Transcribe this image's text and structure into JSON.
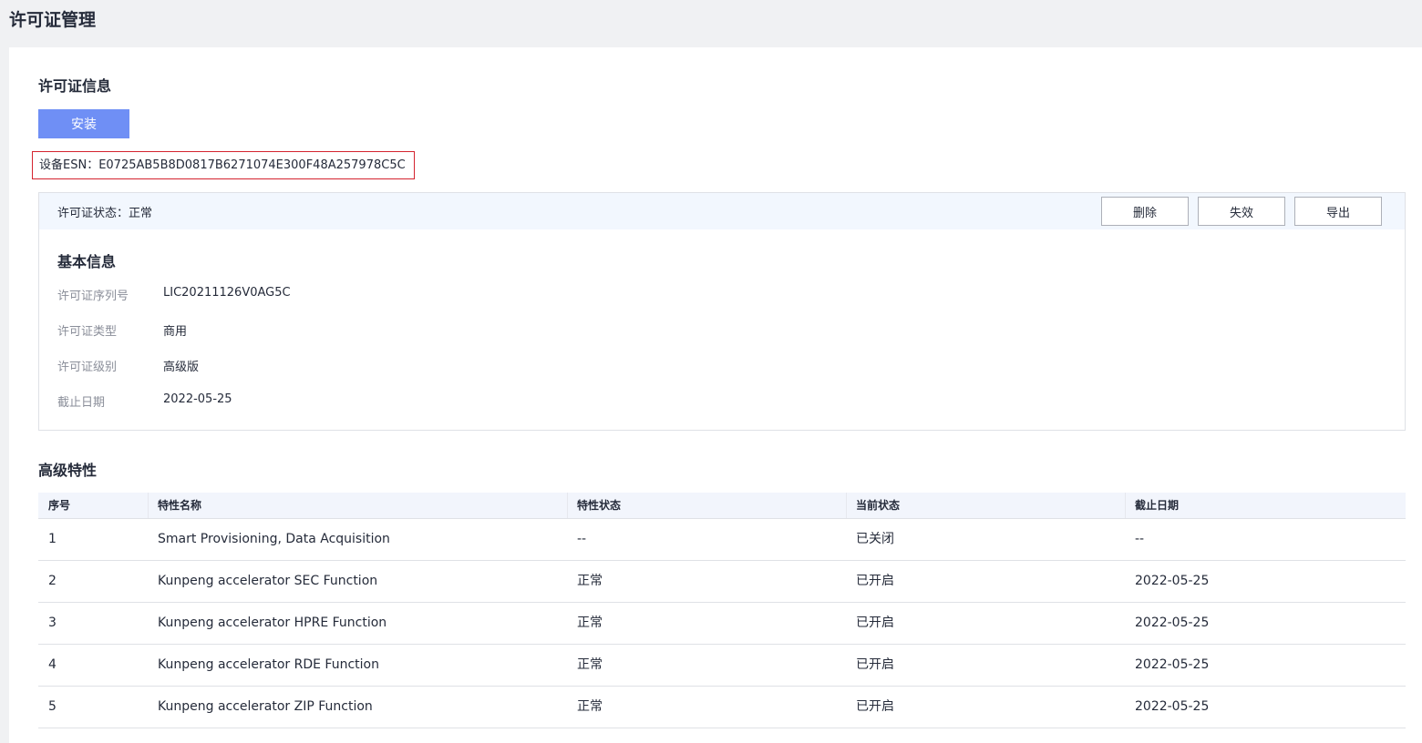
{
  "page": {
    "title": "许可证管理"
  },
  "license_info": {
    "section_title": "许可证信息",
    "install_label": "安装",
    "esn_text": "设备ESN：E0725AB5B8D0817B6271074E300F48A257978C5C",
    "card": {
      "status_text": "许可证状态：正常",
      "actions": {
        "delete": "删除",
        "invalidate": "失效",
        "export": "导出"
      },
      "basic_title": "基本信息",
      "fields": [
        {
          "label": "许可证序列号",
          "value": "LIC20211126V0AG5C"
        },
        {
          "label": "许可证类型",
          "value": "商用"
        },
        {
          "label": "许可证级别",
          "value": "高级版"
        },
        {
          "label": "截止日期",
          "value": "2022-05-25"
        }
      ]
    }
  },
  "features": {
    "section_title": "高级特性",
    "columns": [
      "序号",
      "特性名称",
      "特性状态",
      "当前状态",
      "截止日期"
    ],
    "rows": [
      [
        "1",
        "Smart Provisioning, Data Acquisition",
        "--",
        "已关闭",
        "--"
      ],
      [
        "2",
        "Kunpeng accelerator SEC Function",
        "正常",
        "已开启",
        "2022-05-25"
      ],
      [
        "3",
        "Kunpeng accelerator HPRE Function",
        "正常",
        "已开启",
        "2022-05-25"
      ],
      [
        "4",
        "Kunpeng accelerator RDE Function",
        "正常",
        "已开启",
        "2022-05-25"
      ],
      [
        "5",
        "Kunpeng accelerator ZIP Function",
        "正常",
        "已开启",
        "2022-05-25"
      ]
    ]
  }
}
